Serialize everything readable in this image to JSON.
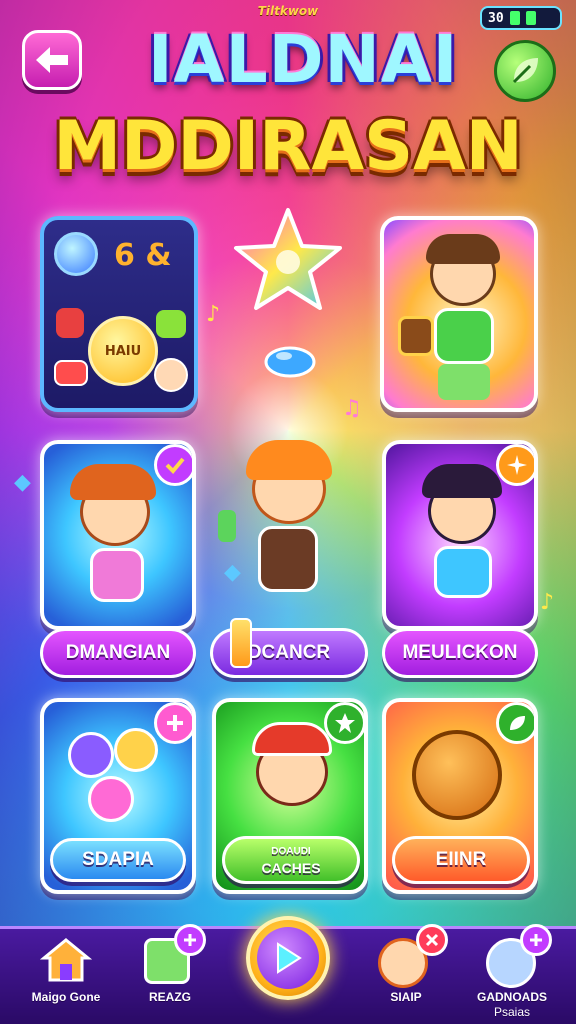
{
  "header": {
    "tiny_title": "Tiltkwow",
    "title_line1": "IALDNAI",
    "title_line2": "MDDIRASAN",
    "status_number": "30"
  },
  "cards": {
    "dark_card": {
      "coin_text": "HAIU"
    },
    "dmangian": {
      "label": "DMANGIAN"
    },
    "dcancr": {
      "label": "DCANCR"
    },
    "meulickon": {
      "label": "MEULICKON"
    },
    "sdapia": {
      "label": "SDAPIA"
    },
    "caches": {
      "label_line1": "DOAUDI",
      "label_line2": "CACHES"
    },
    "eiinr": {
      "label": "EIINR"
    }
  },
  "bottom_nav": [
    {
      "label": "Maigo Gone"
    },
    {
      "label": "REAZG"
    },
    {
      "label": ""
    },
    {
      "label": "SIAIP"
    },
    {
      "label_line1": "GADNOADS",
      "label_line2": "Psaias"
    }
  ],
  "colors": {
    "accent_yellow": "#ffe53a",
    "accent_purple": "#c23cff",
    "accent_green": "#46e042",
    "nav_bg": "#3a1288"
  }
}
